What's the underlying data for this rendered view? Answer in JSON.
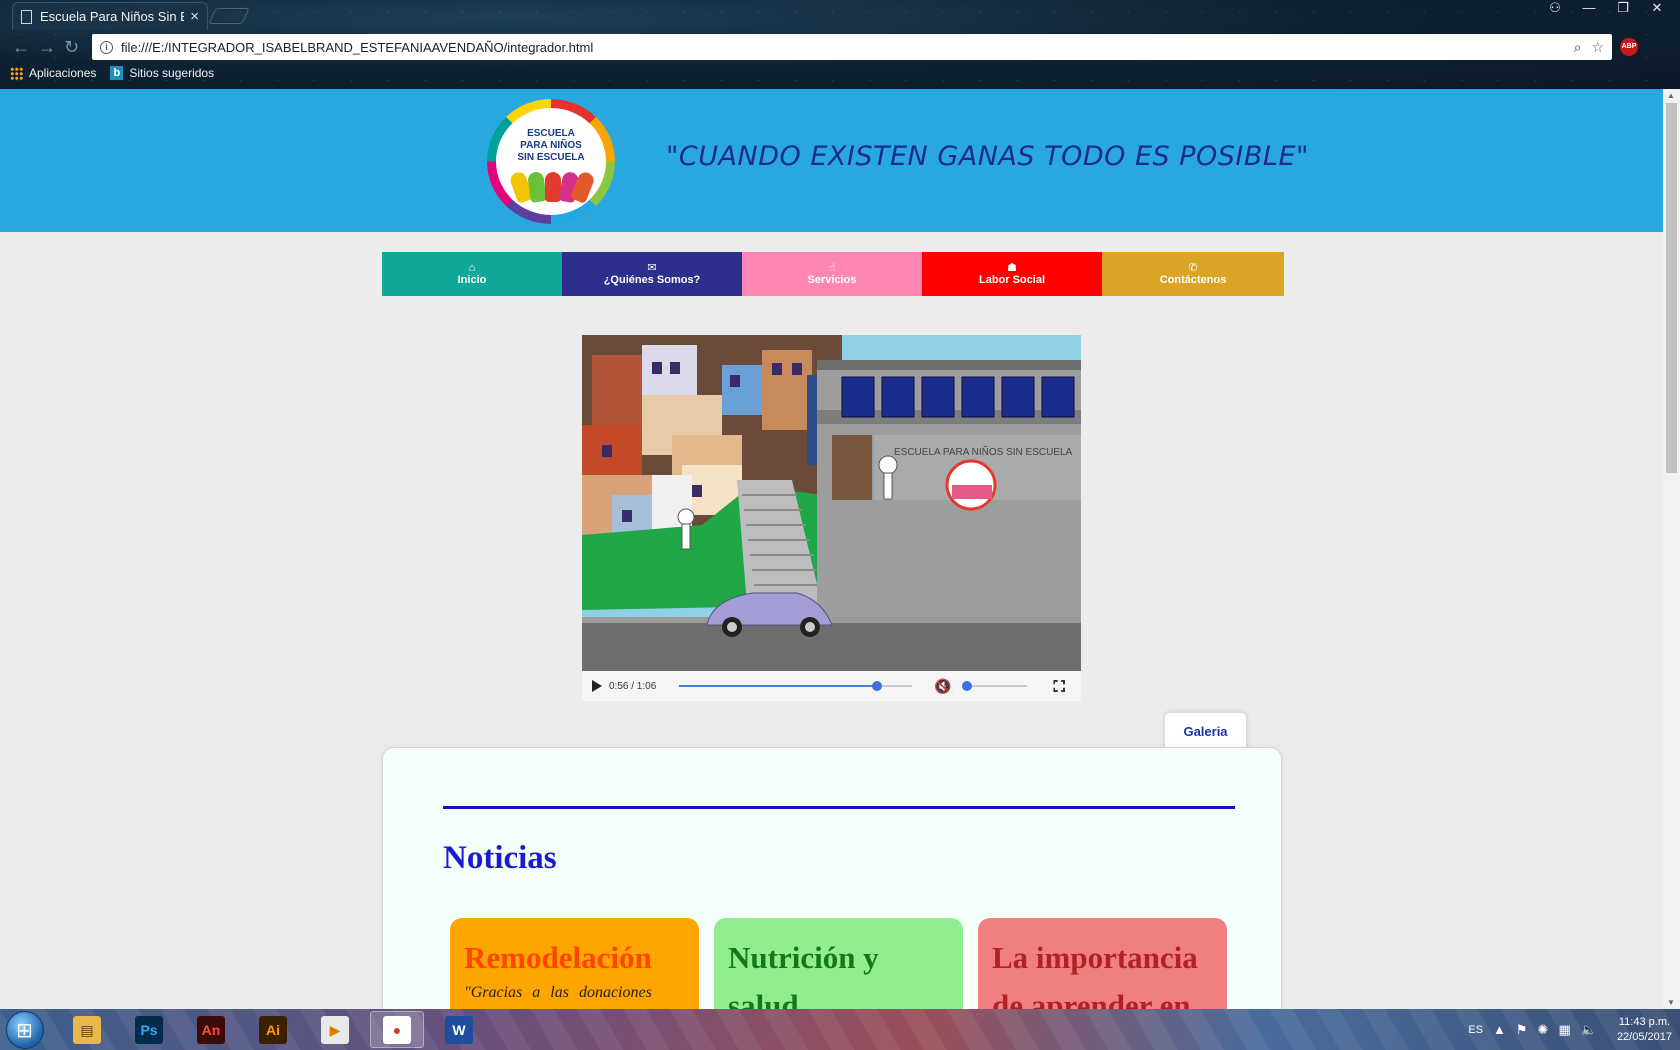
{
  "browser": {
    "tab_title": "Escuela Para Niños Sin E",
    "tab_close": "×",
    "url": "file:///E:/INTEGRADOR_ISABELBRAND_ESTEFANIAAVENDAÑO/integrador.html",
    "bookmarks": [
      {
        "label": "Aplicaciones",
        "icon": "apps-icon"
      },
      {
        "label": "Sitios sugeridos",
        "icon": "bing-icon"
      }
    ],
    "abp_label": "ABP"
  },
  "header": {
    "logo_text": "ESCUELA PARA NIÑOS SIN ESCUELA",
    "slogan": "\"CUANDO EXISTEN GANAS TODO ES POSIBLE\"",
    "background": "#29a8e0"
  },
  "menu": {
    "items": [
      {
        "label": "Inicio",
        "icon": "home-icon",
        "glyph": "⌂",
        "color": "#11a89a"
      },
      {
        "label": "¿Quiénes Somos?",
        "icon": "handshake-icon",
        "glyph": "✉",
        "color": "#2e2f8c"
      },
      {
        "label": "Servicios",
        "icon": "hand-pointer-icon",
        "glyph": "☝",
        "color": "#ff85b4"
      },
      {
        "label": "Labor Social",
        "icon": "group-icon",
        "glyph": "☗",
        "color": "#ff0000"
      },
      {
        "label": "Contáctenos",
        "icon": "phone-icon",
        "glyph": "✆",
        "color": "#dca425"
      }
    ]
  },
  "video": {
    "time": "0:56 / 1:06",
    "progress": 0.85,
    "volume": 0.0,
    "muted": true,
    "school_sign": "ESCUELA PARA NIÑOS SIN ESCUELA"
  },
  "galeria_label": "Galeria",
  "news": {
    "title": "Noticias",
    "cards": [
      {
        "title": "Remodelación",
        "text": "\"Gracias a las donaciones",
        "bg": "#ffa500",
        "title_color": "#ff4500"
      },
      {
        "title": "Nutrición y salud",
        "text": "",
        "bg": "#90ee90",
        "title_color": "#137a13"
      },
      {
        "title": "La importancia de aprender en",
        "text": "",
        "bg": "#f08080",
        "title_color": "#b22222"
      }
    ]
  },
  "taskbar": {
    "apps": [
      {
        "name": "explorer-app",
        "glyph": "▤",
        "bg": "#e8b84a",
        "fg": "#5a3c10"
      },
      {
        "name": "photoshop-app",
        "glyph": "Ps",
        "bg": "#062a4a",
        "fg": "#31a8ff"
      },
      {
        "name": "animate-app",
        "glyph": "An",
        "bg": "#3b0b0b",
        "fg": "#ff4a3a"
      },
      {
        "name": "illustrator-app",
        "glyph": "Ai",
        "bg": "#3a1f00",
        "fg": "#ff9a00"
      },
      {
        "name": "media-player-app",
        "glyph": "▶",
        "bg": "#e9e9e9",
        "fg": "#e07a00"
      },
      {
        "name": "chrome-app",
        "glyph": "●",
        "bg": "#ffffff",
        "fg": "#d33c2e"
      },
      {
        "name": "word-app",
        "glyph": "W",
        "bg": "#1f4e9c",
        "fg": "#ffffff"
      }
    ],
    "lang": "ES",
    "time": "11:43 p.m.",
    "date": "22/05/2017"
  }
}
